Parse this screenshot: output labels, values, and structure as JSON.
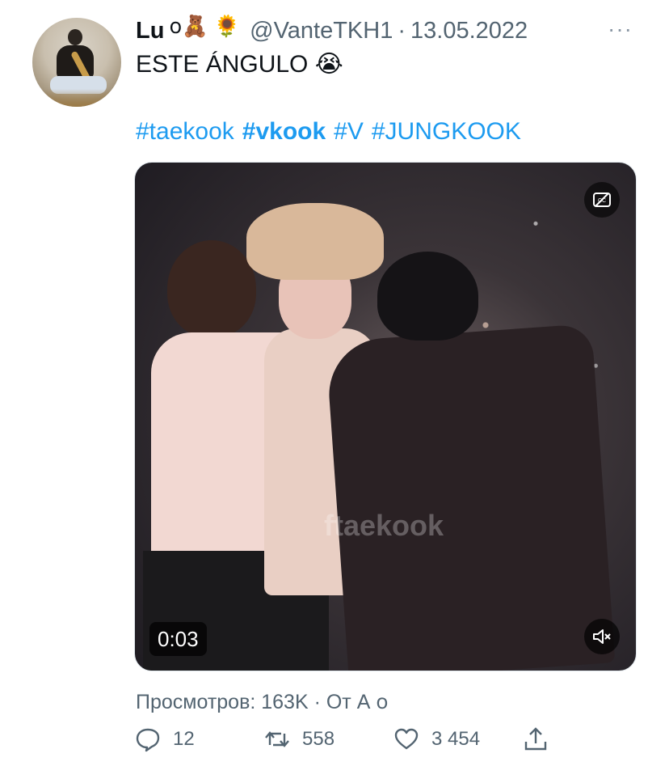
{
  "tweet": {
    "author_name": "Lu",
    "author_emojis": "꧆🧸 🌻",
    "handle": "@VanteTKH1",
    "separator": "·",
    "date": "13.05.2022",
    "more_icon": "···",
    "text": "ESTE ÁNGULO 😭",
    "hashtags": [
      "#taekook",
      "#vkook",
      "#V",
      "#JUNGKOOK"
    ]
  },
  "video": {
    "timestamp": "0:03",
    "watermark": "ftaekook",
    "captions_icon": "cc-icon",
    "mute_icon": "mute-icon"
  },
  "footer": {
    "views_text": "Просмотров: 163K · От А ꧆"
  },
  "actions": {
    "reply_count": "12",
    "retweet_count": "558",
    "like_count": "3 454"
  },
  "colors": {
    "hashtag": "#1d9bf0",
    "secondary_text": "#536471"
  }
}
